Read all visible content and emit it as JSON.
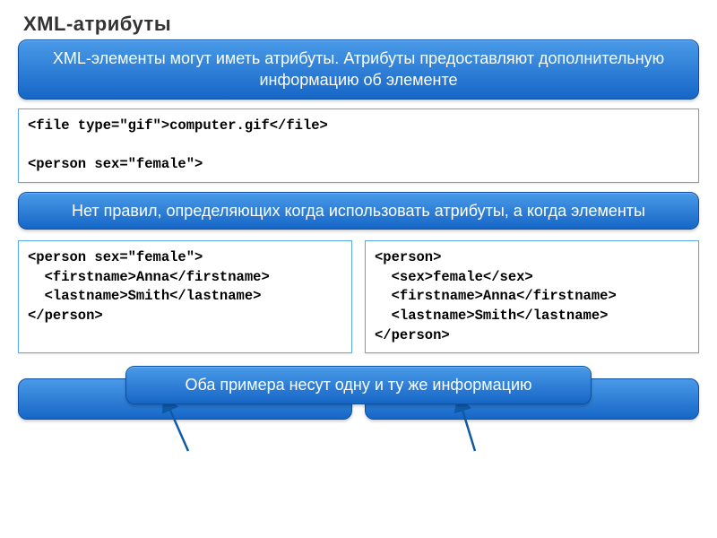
{
  "title": "XML-атрибуты",
  "info1": "XML-элементы могут иметь атрибуты. Атрибуты предоставляют дополнительную информацию об элементе",
  "code1": "<file type=\"gif\">computer.gif</file>\n\n<person sex=\"female\">",
  "info2": "Нет правил, определяющих когда использовать атрибуты, а когда элементы",
  "code_left": "<person sex=\"female\">\n  <firstname>Anna</firstname>\n  <lastname>Smith</lastname>\n</person>",
  "code_right": "<person>\n  <sex>female</sex>\n  <firstname>Anna</firstname>\n  <lastname>Smith</lastname>\n</person>",
  "info3": "Оба примера несут одну и ту же информацию",
  "colors": {
    "blue_gradient_top": "#4a9ae8",
    "blue_gradient_bottom": "#1666c7",
    "border": "#5aa9ee"
  }
}
